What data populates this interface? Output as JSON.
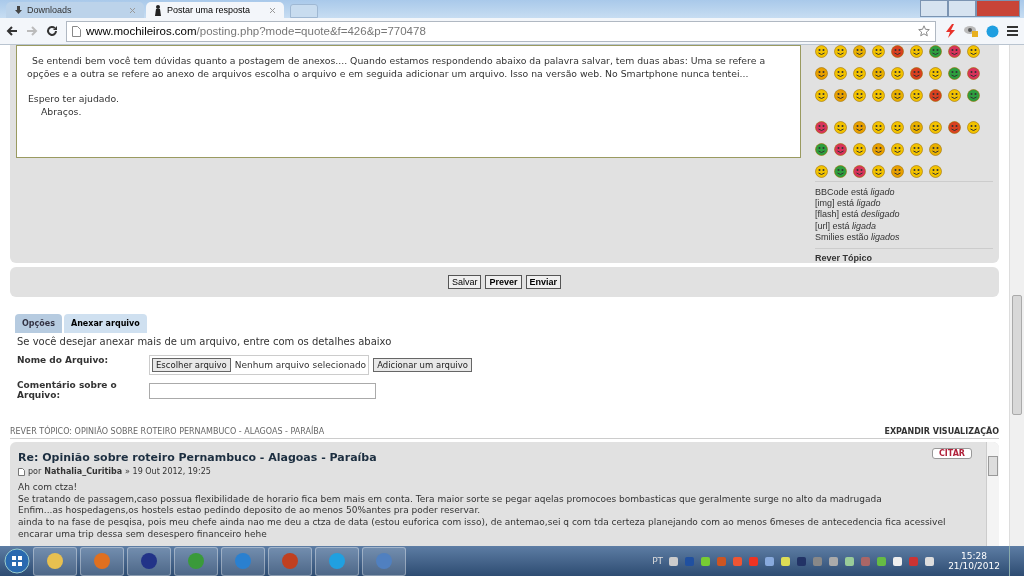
{
  "browser": {
    "tabs": [
      {
        "label": "Downloads",
        "selected": false
      },
      {
        "label": "Postar uma resposta",
        "selected": true
      }
    ],
    "url_host": "www.mochileiros.com",
    "url_path": "/posting.php?mode=quote&f=426&p=770478"
  },
  "editor": {
    "paragraphs": [
      "Se entendi bem você tem dúvidas quanto a postagem de anexos.... Quando estamos respondendo abaixo da palavra salvar, tem duas abas: Uma se refere a opções e a outra se refere ao anexo de arquivos escolha o arquivo e em seguida adicionar um arquivo. Isso na versão web. No Smartphone nunca tentei...",
      "Espero ter ajudado.",
      "Abraços."
    ]
  },
  "sidebar": {
    "status": [
      "BBCode está *ligado*",
      "[img] está *ligado*",
      "[flash] está *desligado*",
      "[url] está *ligada*",
      "Smilies estão *ligados*"
    ],
    "review_link": "Rever Tópico"
  },
  "actions": [
    "Salvar",
    "Prever",
    "Enviar"
  ],
  "panel_tabs": [
    {
      "label": "Opções",
      "selected": false
    },
    {
      "label": "Anexar arquivo",
      "selected": true
    }
  ],
  "attach": {
    "intro": "Se você desejar anexar mais de um arquivo, entre com os detalhes abaixo",
    "file_label": "Nome do Arquivo:",
    "choose_button": "Escolher arquivo",
    "no_file": "Nenhum arquivo selecionado",
    "add_button": "Adicionar um arquivo",
    "comment_label": "Comentário sobre o Arquivo:"
  },
  "review": {
    "heading": "REVER TÓPICO: OPINIÃO SOBRE ROTEIRO PERNAMBUCO - ALAGOAS - PARAÍBA",
    "expand": "EXPANDIR VISUALIZAÇÃO",
    "post": {
      "title": "Re: Opinião sobre roteiro Pernambuco - Alagoas - Paraíba",
      "by": "por",
      "author": "Nathalia_Curitiba",
      "date": "» 19 Out 2012, 19:25",
      "quote": "CITAR",
      "lines": [
        "Ah com ctza!",
        "Se tratando de passagem,caso possua flexibilidade de horario fica bem mais em conta. Tera maior sorte se pegar aqelas promocoes bombasticas que geralmente surge no alto da madrugada",
        "Enfim...as hospedagens,os hostels estao pedindo deposito de ao menos 50%antes pra poder reservar.",
        "ainda to na fase de pesqisa, pois meu chefe ainda nao me deu a ctza de data (estou euforica com isso), de antemao,sei q com tda certeza planejando com ao menos 6meses de antecedencia fica acessivel encarar uma trip dessa sem desespero financeiro hehe"
      ]
    }
  },
  "taskbar": {
    "language": "PT",
    "time": "15:28",
    "date": "21/10/2012"
  }
}
